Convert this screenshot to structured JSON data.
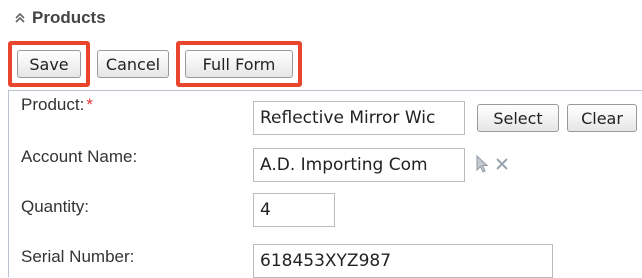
{
  "header": {
    "title": "Products",
    "collapse_icon": "chevron-double-up-icon"
  },
  "toolbar": {
    "save_label": "Save",
    "cancel_label": "Cancel",
    "full_form_label": "Full Form",
    "highlight_color": "#e8452c"
  },
  "form": {
    "product": {
      "label": "Product:",
      "required_marker": "*",
      "value": "Reflective Mirror Wic",
      "select_label": "Select",
      "clear_label": "Clear"
    },
    "account_name": {
      "label": "Account Name:",
      "value": "A.D. Importing Com",
      "select_icon": "cursor-arrow-icon",
      "clear_icon": "close-x-icon"
    },
    "quantity": {
      "label": "Quantity:",
      "value": "4"
    },
    "serial_number": {
      "label": "Serial Number:",
      "value": "618453XYZ987"
    }
  }
}
